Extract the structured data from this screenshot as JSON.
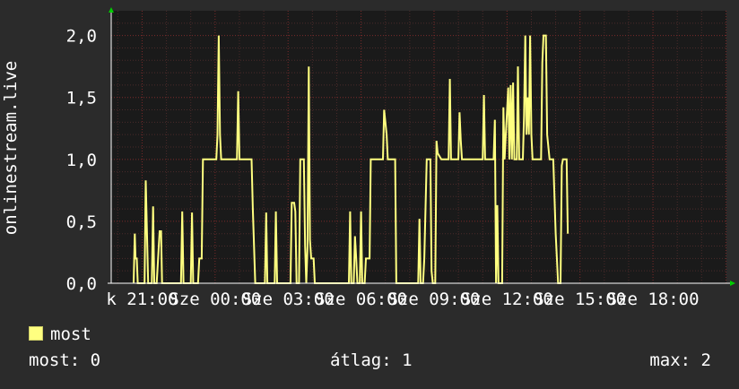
{
  "chart_data": {
    "type": "line",
    "title": "",
    "ylabel": "onlinestream.live",
    "ylim": [
      0,
      2.2
    ],
    "yticks": [
      "0,0",
      "0,5",
      "1,0",
      "1,5",
      "2,0"
    ],
    "ytick_values": [
      0,
      0.5,
      1,
      1.5,
      2
    ],
    "xticks": [
      "k 21:00",
      "Sze 00:00",
      "Sze 03:00",
      "Sze 06:00",
      "Sze 09:00",
      "Sze 12:00",
      "Sze 15:00",
      "Sze 18:00"
    ],
    "xtick_hours": [
      0,
      3,
      6,
      9,
      12,
      15,
      18,
      21
    ],
    "xlim_hours": [
      -1.27,
      24.02
    ],
    "grid": true,
    "colors": {
      "line": "#ffff80",
      "grid_major": "#7a2a2a",
      "grid_minor": "#4a2a2a",
      "axis": "#ffffff",
      "arrow": "#00cc00",
      "plot_bg": "#1a1a1a"
    },
    "series": [
      {
        "name": "most",
        "points": [
          [
            -0.35,
            0
          ],
          [
            -0.3,
            0.4
          ],
          [
            -0.27,
            0.2
          ],
          [
            -0.22,
            0.2
          ],
          [
            -0.18,
            0
          ],
          [
            0.1,
            0
          ],
          [
            0.15,
            0.83
          ],
          [
            0.2,
            0.4
          ],
          [
            0.25,
            0
          ],
          [
            0.4,
            0
          ],
          [
            0.45,
            0.62
          ],
          [
            0.5,
            0
          ],
          [
            0.6,
            0
          ],
          [
            0.68,
            0.28
          ],
          [
            0.72,
            0.42
          ],
          [
            0.78,
            0.42
          ],
          [
            0.82,
            0
          ],
          [
            1.6,
            0
          ],
          [
            1.65,
            0.58
          ],
          [
            1.7,
            0
          ],
          [
            2.0,
            0
          ],
          [
            2.05,
            0.57
          ],
          [
            2.1,
            0
          ],
          [
            2.3,
            0
          ],
          [
            2.35,
            0.2
          ],
          [
            2.45,
            0.2
          ],
          [
            2.5,
            1.0
          ],
          [
            3.05,
            1.0
          ],
          [
            3.1,
            1.2
          ],
          [
            3.15,
            2.0
          ],
          [
            3.2,
            1.2
          ],
          [
            3.25,
            1.0
          ],
          [
            3.9,
            1.0
          ],
          [
            3.95,
            1.55
          ],
          [
            4.0,
            1.0
          ],
          [
            4.5,
            1.0
          ],
          [
            4.55,
            0.6
          ],
          [
            4.65,
            0
          ],
          [
            5.05,
            0
          ],
          [
            5.1,
            0.57
          ],
          [
            5.15,
            0
          ],
          [
            5.45,
            0
          ],
          [
            5.5,
            0.58
          ],
          [
            5.55,
            0
          ],
          [
            6.1,
            0
          ],
          [
            6.15,
            0.65
          ],
          [
            6.25,
            0.65
          ],
          [
            6.3,
            0.58
          ],
          [
            6.35,
            0
          ],
          [
            6.45,
            0
          ],
          [
            6.5,
            1.0
          ],
          [
            6.65,
            1.0
          ],
          [
            6.7,
            0.3
          ],
          [
            6.75,
            0
          ],
          [
            6.8,
            0.3
          ],
          [
            6.85,
            1.75
          ],
          [
            6.9,
            0.35
          ],
          [
            6.95,
            0.2
          ],
          [
            7.05,
            0.2
          ],
          [
            7.1,
            0
          ],
          [
            8.5,
            0
          ],
          [
            8.55,
            0.58
          ],
          [
            8.6,
            0
          ],
          [
            8.7,
            0
          ],
          [
            8.75,
            0.38
          ],
          [
            8.8,
            0.2
          ],
          [
            8.85,
            0
          ],
          [
            8.95,
            0
          ],
          [
            9.0,
            0.58
          ],
          [
            9.05,
            0
          ],
          [
            9.15,
            0
          ],
          [
            9.2,
            0.2
          ],
          [
            9.35,
            0.2
          ],
          [
            9.4,
            1.0
          ],
          [
            9.9,
            1.0
          ],
          [
            9.95,
            1.4
          ],
          [
            10.05,
            1.2
          ],
          [
            10.1,
            1.0
          ],
          [
            10.4,
            1.0
          ],
          [
            10.45,
            0
          ],
          [
            11.35,
            0
          ],
          [
            11.4,
            0.52
          ],
          [
            11.45,
            0
          ],
          [
            11.55,
            0
          ],
          [
            11.6,
            0.2
          ],
          [
            11.7,
            1.0
          ],
          [
            11.85,
            1.0
          ],
          [
            11.9,
            0.1
          ],
          [
            11.95,
            0
          ],
          [
            12.05,
            0
          ],
          [
            12.1,
            1.15
          ],
          [
            12.15,
            1.05
          ],
          [
            12.3,
            1.0
          ],
          [
            12.6,
            1.0
          ],
          [
            12.65,
            1.65
          ],
          [
            12.7,
            1.0
          ],
          [
            13.0,
            1.0
          ],
          [
            13.05,
            1.38
          ],
          [
            13.1,
            1.15
          ],
          [
            13.15,
            1.0
          ],
          [
            14.0,
            1.0
          ],
          [
            14.05,
            1.52
          ],
          [
            14.1,
            1.0
          ],
          [
            14.45,
            1.0
          ],
          [
            14.5,
            1.32
          ],
          [
            14.55,
            0
          ],
          [
            14.6,
            0.63
          ],
          [
            14.65,
            0
          ],
          [
            14.8,
            0
          ],
          [
            14.85,
            1.42
          ],
          [
            14.9,
            1.0
          ],
          [
            15.05,
            1.58
          ],
          [
            15.1,
            1.0
          ],
          [
            15.15,
            1.6
          ],
          [
            15.2,
            1.0
          ],
          [
            15.25,
            1.62
          ],
          [
            15.3,
            1.0
          ],
          [
            15.4,
            1.0
          ],
          [
            15.45,
            1.75
          ],
          [
            15.5,
            1.0
          ],
          [
            15.65,
            1.0
          ],
          [
            15.7,
            1.35
          ],
          [
            15.75,
            2.0
          ],
          [
            15.8,
            1.2
          ],
          [
            15.85,
            1.5
          ],
          [
            15.9,
            1.2
          ],
          [
            15.95,
            2.0
          ],
          [
            16.0,
            1.2
          ],
          [
            16.05,
            1.0
          ],
          [
            16.4,
            1.0
          ],
          [
            16.45,
            1.78
          ],
          [
            16.5,
            2.0
          ],
          [
            16.6,
            2.0
          ],
          [
            16.65,
            1.2
          ],
          [
            16.75,
            1.0
          ],
          [
            16.9,
            1.0
          ],
          [
            17.0,
            0.4
          ],
          [
            17.1,
            0
          ],
          [
            17.2,
            0
          ],
          [
            17.25,
            0.95
          ],
          [
            17.3,
            1.0
          ],
          [
            17.45,
            1.0
          ],
          [
            17.5,
            0.4
          ]
        ]
      }
    ]
  },
  "legend": {
    "series_label": "most"
  },
  "stats": {
    "current": "most: 0",
    "average": "átlag: 1",
    "max": "max: 2"
  }
}
